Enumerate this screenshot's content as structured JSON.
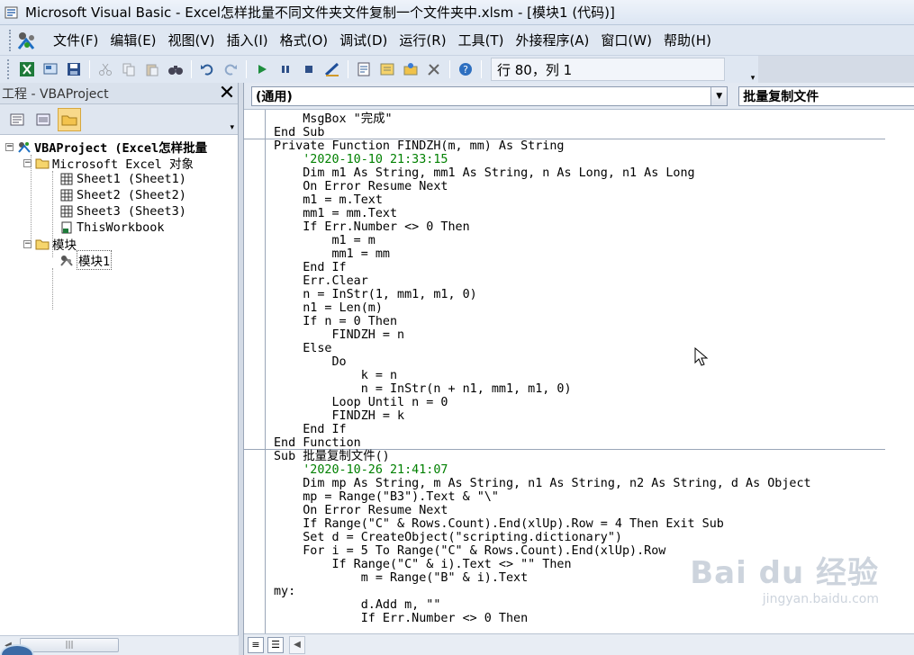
{
  "window": {
    "title": "Microsoft Visual Basic - Excel怎样批量不同文件夹文件复制一个文件夹中.xlsm - [模块1 (代码)]"
  },
  "menu": [
    "文件(F)",
    "编辑(E)",
    "视图(V)",
    "插入(I)",
    "格式(O)",
    "调试(D)",
    "运行(R)",
    "工具(T)",
    "外接程序(A)",
    "窗口(W)",
    "帮助(H)"
  ],
  "toolbar": {
    "buttons": [
      "view-excel-icon",
      "insert-module-icon",
      "save-icon",
      "cut-icon",
      "copy-icon",
      "paste-icon",
      "find-icon",
      "undo-icon",
      "redo-icon",
      "run-icon",
      "break-icon",
      "reset-icon",
      "design-mode-icon",
      "project-explorer-icon",
      "properties-icon",
      "object-browser-icon",
      "toolbox-icon",
      "help-icon"
    ],
    "position": "行 80，列 1"
  },
  "project": {
    "title": "工程 - VBAProject",
    "root": "VBAProject (Excel怎样批量",
    "folder_objects": "Microsoft Excel 对象",
    "sheets": [
      "Sheet1 (Sheet1)",
      "Sheet2 (Sheet2)",
      "Sheet3 (Sheet3)"
    ],
    "workbook": "ThisWorkbook",
    "folder_modules": "模块",
    "module": "模块1"
  },
  "code": {
    "object_combo": "(通用)",
    "proc_combo": "批量复制文件",
    "lines": [
      {
        "t": "    MsgBox \"完成\"",
        "c": ""
      },
      {
        "t": "End Sub",
        "c": "divider"
      },
      {
        "t": "Private Function FINDZH(m, mm) As String",
        "c": ""
      },
      {
        "t": "    '2020-10-10 21:33:15",
        "c": "green"
      },
      {
        "t": "    Dim m1 As String, mm1 As String, n As Long, n1 As Long",
        "c": ""
      },
      {
        "t": "    On Error Resume Next",
        "c": ""
      },
      {
        "t": "    m1 = m.Text",
        "c": ""
      },
      {
        "t": "    mm1 = mm.Text",
        "c": ""
      },
      {
        "t": "    If Err.Number <> 0 Then",
        "c": ""
      },
      {
        "t": "        m1 = m",
        "c": ""
      },
      {
        "t": "        mm1 = mm",
        "c": ""
      },
      {
        "t": "    End If",
        "c": ""
      },
      {
        "t": "    Err.Clear",
        "c": ""
      },
      {
        "t": "    n = InStr(1, mm1, m1, 0)",
        "c": ""
      },
      {
        "t": "    n1 = Len(m)",
        "c": ""
      },
      {
        "t": "    If n = 0 Then",
        "c": ""
      },
      {
        "t": "        FINDZH = n",
        "c": ""
      },
      {
        "t": "    Else",
        "c": ""
      },
      {
        "t": "        Do",
        "c": ""
      },
      {
        "t": "            k = n",
        "c": ""
      },
      {
        "t": "            n = InStr(n + n1, mm1, m1, 0)",
        "c": ""
      },
      {
        "t": "        Loop Until n = 0",
        "c": ""
      },
      {
        "t": "        FINDZH = k",
        "c": ""
      },
      {
        "t": "    End If",
        "c": ""
      },
      {
        "t": "End Function",
        "c": "divider"
      },
      {
        "t": "Sub 批量复制文件()",
        "c": ""
      },
      {
        "t": "    '2020-10-26 21:41:07",
        "c": "green"
      },
      {
        "t": "    Dim mp As String, m As String, n1 As String, n2 As String, d As Object",
        "c": ""
      },
      {
        "t": "    mp = Range(\"B3\").Text & \"\\\"",
        "c": ""
      },
      {
        "t": "    On Error Resume Next",
        "c": ""
      },
      {
        "t": "    If Range(\"C\" & Rows.Count).End(xlUp).Row = 4 Then Exit Sub",
        "c": ""
      },
      {
        "t": "    Set d = CreateObject(\"scripting.dictionary\")",
        "c": ""
      },
      {
        "t": "    For i = 5 To Range(\"C\" & Rows.Count).End(xlUp).Row",
        "c": ""
      },
      {
        "t": "        If Range(\"C\" & i).Text <> \"\" Then",
        "c": ""
      },
      {
        "t": "            m = Range(\"B\" & i).Text",
        "c": ""
      },
      {
        "t": "my:",
        "c": ""
      },
      {
        "t": "            d.Add m, \"\"",
        "c": ""
      },
      {
        "t": "            If Err.Number <> 0 Then",
        "c": ""
      }
    ]
  },
  "watermark": {
    "brand": "Bai du 经验",
    "url": "jingyan.baidu.com"
  },
  "colors": {
    "comment": "#008000",
    "selected_tab": "#f8d98b"
  }
}
